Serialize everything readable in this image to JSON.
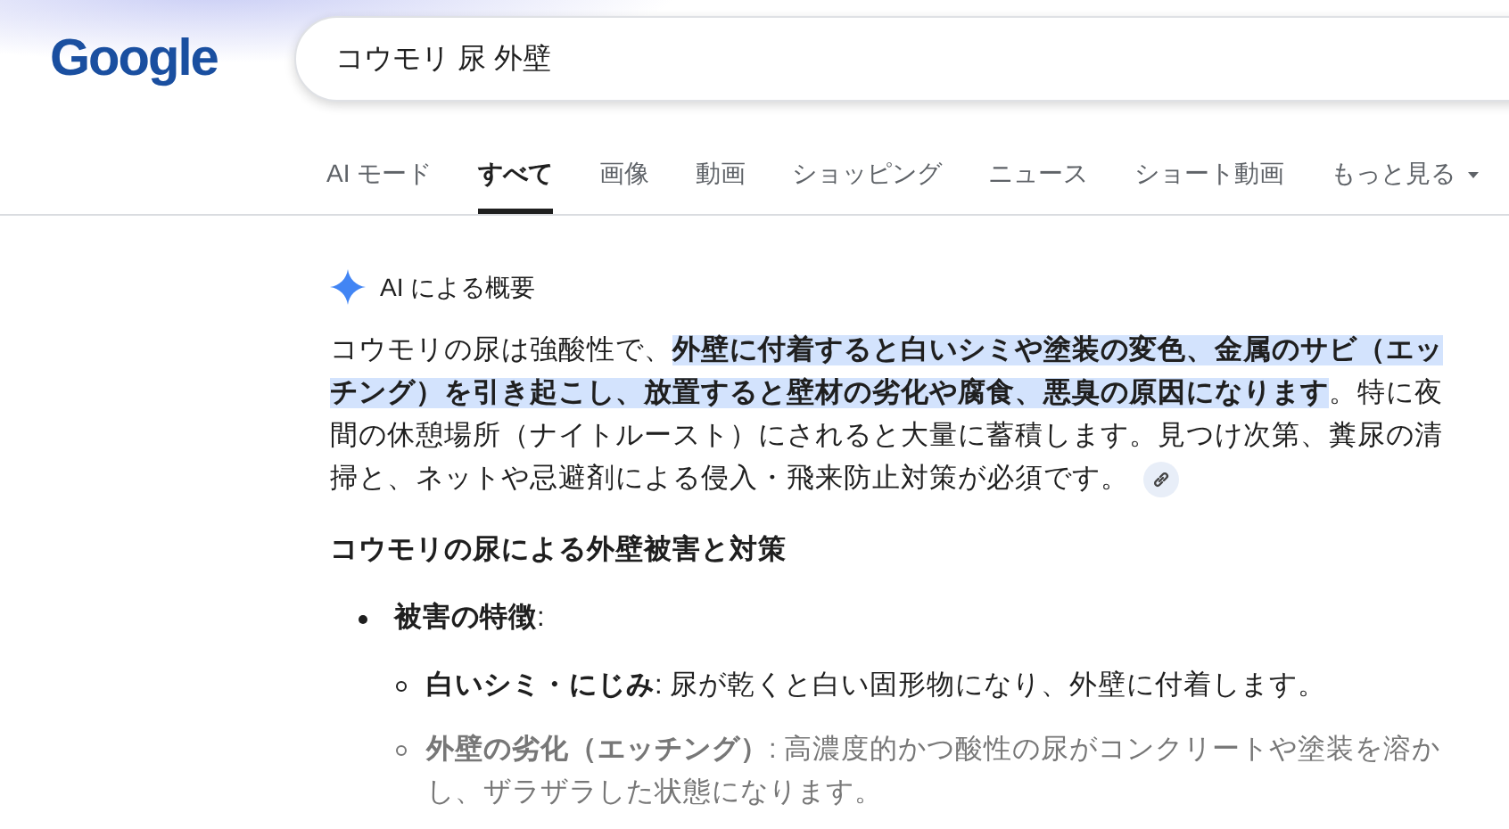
{
  "logo": "Google",
  "search": {
    "value": "コウモリ 尿 外壁"
  },
  "tabs": [
    {
      "label": "AI モード",
      "selected": false
    },
    {
      "label": "すべて",
      "selected": true
    },
    {
      "label": "画像",
      "selected": false
    },
    {
      "label": "動画",
      "selected": false
    },
    {
      "label": "ショッピング",
      "selected": false
    },
    {
      "label": "ニュース",
      "selected": false
    },
    {
      "label": "ショート動画",
      "selected": false
    },
    {
      "label": "もっと見る",
      "selected": false,
      "dropdown": true
    }
  ],
  "ai_overview": {
    "title": "AI による概要",
    "summary": "コウモリの尿は強酸性で、**外壁に付着すると白いシミや塗装の変色、金属のサビ（エッチング）を引き起こし、放置すると壁材の劣化や腐食、悪臭の原因になります**。特に夜間の休憩場所（ナイトルースト）にされると大量に蓄積します。見つけ次第、糞尿の清掃と、ネットや忌避剤による侵入・飛来防止対策が必須です。",
    "heading": "コウモリの尿による外壁被害と対策",
    "items": [
      {
        "term": "被害の特徴",
        "text": ":",
        "children": [
          {
            "term": "白いシミ・にじみ",
            "text": ": 尿が乾くと白い固形物になり、外壁に付着します。"
          },
          {
            "term": "外壁の劣化（エッチング）",
            "text": ": 高濃度的かつ酸性の尿がコンクリートや塗装を溶かし、ザラザラした状態になります。"
          }
        ]
      }
    ]
  }
}
